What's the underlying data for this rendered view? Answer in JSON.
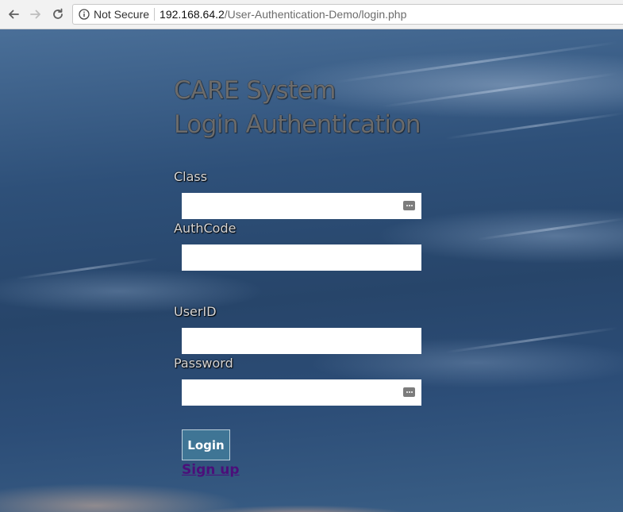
{
  "browser": {
    "security_label": "Not Secure",
    "url_host": "192.168.64.2",
    "url_path": "/User-Authentication-Demo/login.php"
  },
  "page": {
    "title_line1": "CARE System",
    "title_line2": "Login Authentication",
    "fields": [
      {
        "label": "Class",
        "value": ""
      },
      {
        "label": "AuthCode",
        "value": ""
      },
      {
        "label": "UserID",
        "value": ""
      },
      {
        "label": "Password",
        "value": ""
      }
    ],
    "login_label": "Login",
    "signup_label": "Sign up"
  },
  "colors": {
    "login_button": "#3f7595",
    "signup_link": "#4b0f7a"
  }
}
